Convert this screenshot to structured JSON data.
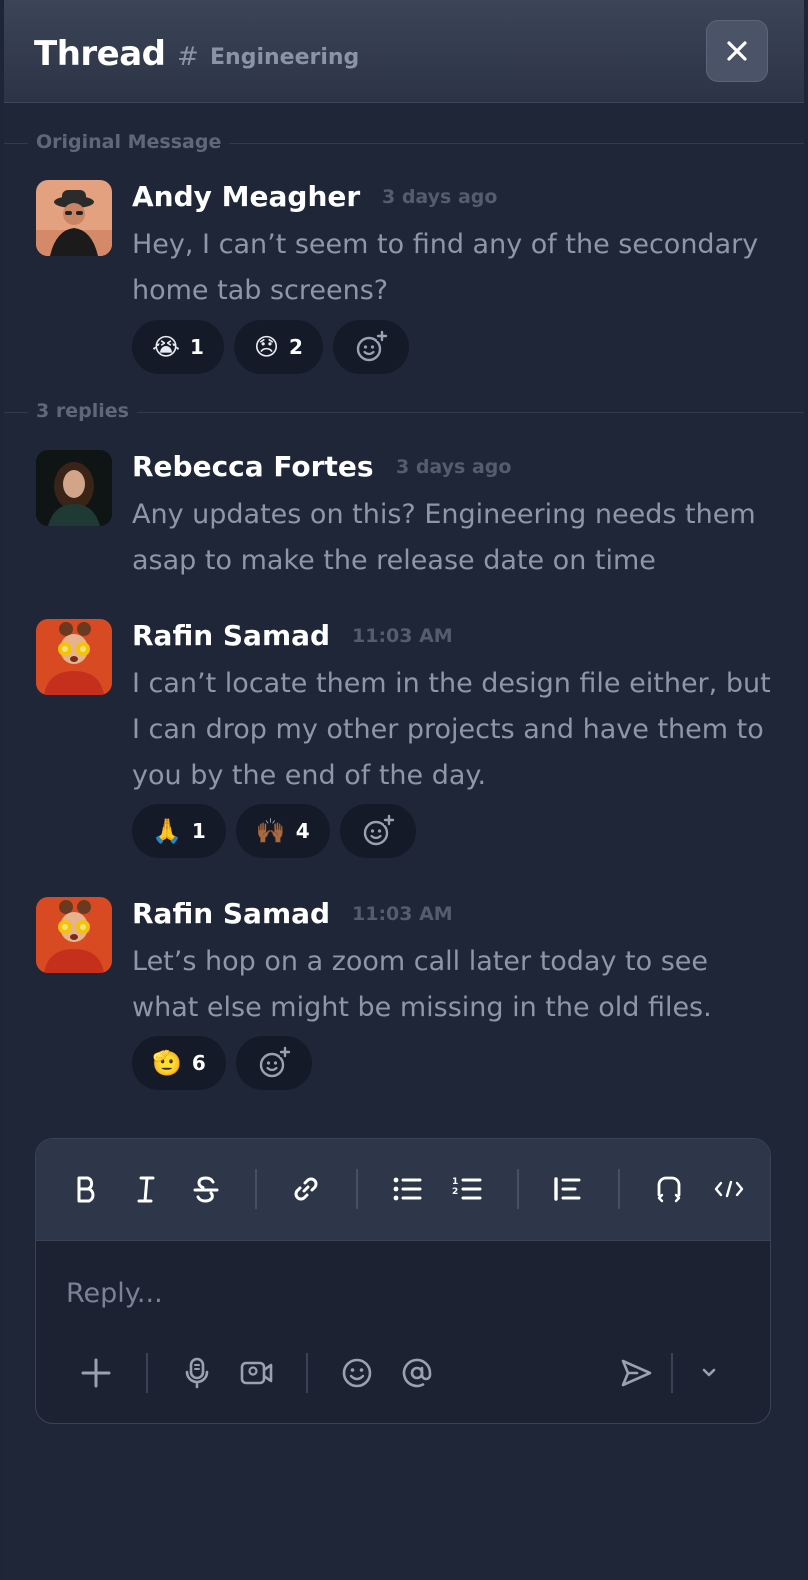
{
  "header": {
    "title": "Thread",
    "channel_prefix": "#",
    "channel": "Engineering"
  },
  "original": {
    "label": "Original Message",
    "author": "Andy Meagher",
    "time": "3 days ago",
    "text": "Hey, I can’t seem to find any of the secondary home tab screens?",
    "reactions": [
      {
        "emoji": "😭",
        "count": "1"
      },
      {
        "emoji": "😞",
        "count": "2"
      }
    ]
  },
  "replies_label": "3 replies",
  "replies": [
    {
      "author": "Rebecca Fortes",
      "time": "3 days ago",
      "text": "Any updates on this? Engineering needs them asap to make the release date on time"
    },
    {
      "author": "Rafin Samad",
      "time": "11:03 AM",
      "text": "I can’t locate them in the design file either, but I can drop my other projects and have them to you by the end of the day.",
      "reactions": [
        {
          "emoji": "🙏",
          "count": "1"
        },
        {
          "emoji": "🙌🏾",
          "count": "4"
        }
      ]
    },
    {
      "author": "Rafin Samad",
      "time": "11:03 AM",
      "text": "Let’s hop on a zoom call later today to see what else might be missing in the old files.",
      "reactions": [
        {
          "emoji": "🫡",
          "count": "6"
        }
      ]
    }
  ],
  "composer": {
    "placeholder": "Reply..."
  },
  "icons": {
    "toolbar": [
      "bold-icon",
      "italic-icon",
      "strikethrough-icon",
      "link-icon",
      "bullet-list-icon",
      "numbered-list-icon",
      "blockquote-icon",
      "code-block-icon",
      "code-icon"
    ],
    "bottom": [
      "plus-icon",
      "microphone-icon",
      "video-icon",
      "emoji-icon",
      "mention-icon",
      "send-icon",
      "chevron-down-icon"
    ]
  },
  "colors": {
    "background": "#1f2637",
    "header": "#343c4f",
    "text_muted": "#8e96a8",
    "pill": "#141a27"
  }
}
